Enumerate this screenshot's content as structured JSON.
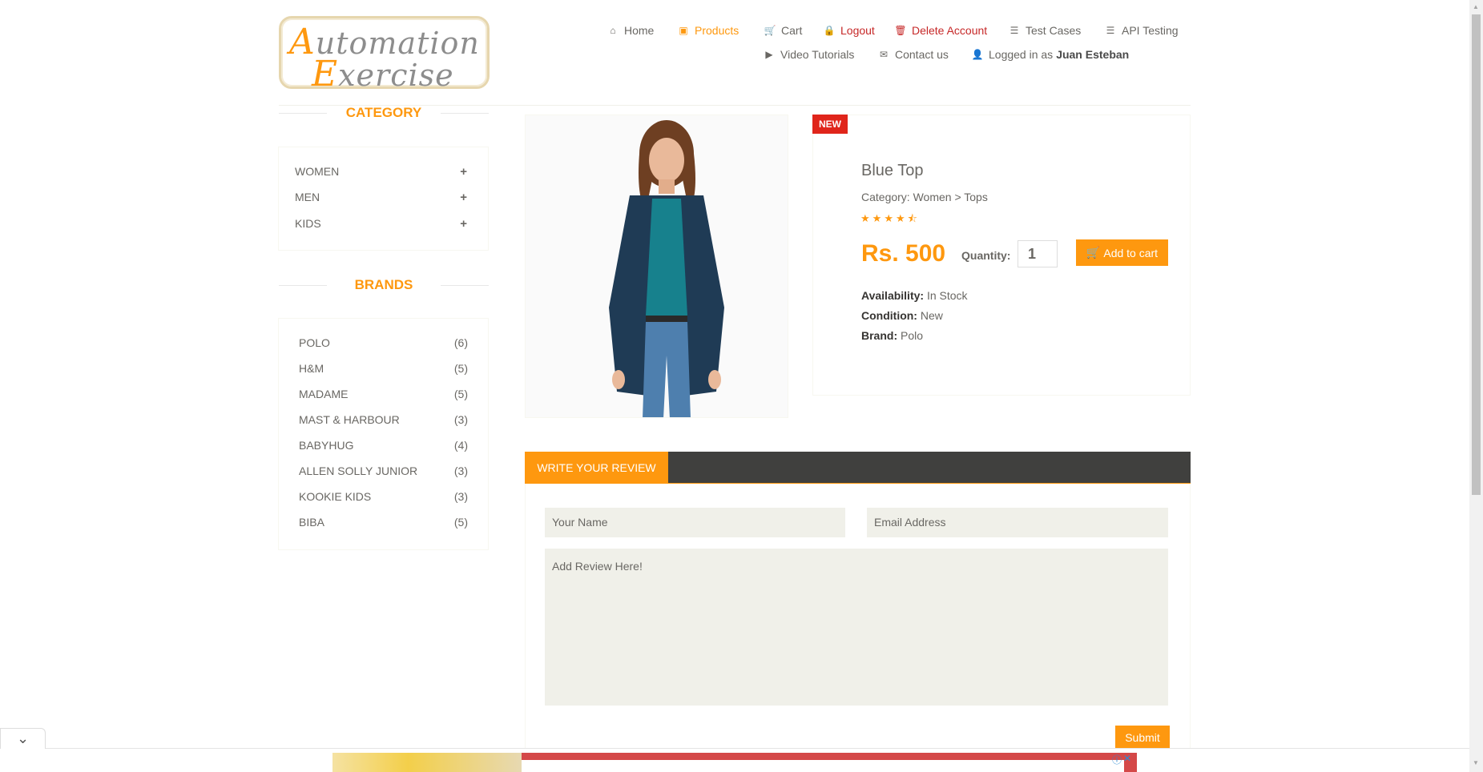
{
  "header": {
    "logo_line1_cap": "A",
    "logo_line1_rest": "utomation",
    "logo_line2_cap": "E",
    "logo_line2_rest": "xercise",
    "nav": {
      "home": "Home",
      "products": "Products",
      "cart": "Cart",
      "logout": "Logout",
      "delete_account": "Delete Account",
      "test_cases": "Test Cases",
      "api_testing": "API Testing",
      "video_tutorials": "Video Tutorials",
      "contact_us": "Contact us",
      "logged_in_prefix": "Logged in as",
      "logged_in_user": "Juan Esteban"
    }
  },
  "sidebar": {
    "category_title": "CATEGORY",
    "categories": [
      "WOMEN",
      "MEN",
      "KIDS"
    ],
    "brands_title": "BRANDS",
    "brands": [
      {
        "name": "POLO",
        "count": "(6)"
      },
      {
        "name": "H&M",
        "count": "(5)"
      },
      {
        "name": "MADAME",
        "count": "(5)"
      },
      {
        "name": "MAST & HARBOUR",
        "count": "(3)"
      },
      {
        "name": "BABYHUG",
        "count": "(4)"
      },
      {
        "name": "ALLEN SOLLY JUNIOR",
        "count": "(3)"
      },
      {
        "name": "KOOKIE KIDS",
        "count": "(3)"
      },
      {
        "name": "BIBA",
        "count": "(5)"
      }
    ]
  },
  "product": {
    "badge": "NEW",
    "name": "Blue Top",
    "category": "Category: Women > Tops",
    "rating": 4.5,
    "price": "Rs. 500",
    "quantity_label": "Quantity:",
    "quantity_value": "1",
    "add_to_cart": "Add to cart",
    "availability_label": "Availability:",
    "availability_value": "In Stock",
    "condition_label": "Condition:",
    "condition_value": "New",
    "brand_label": "Brand:",
    "brand_value": "Polo"
  },
  "review": {
    "tab": "WRITE YOUR REVIEW",
    "name_placeholder": "Your Name",
    "email_placeholder": "Email Address",
    "review_placeholder": "Add Review Here!",
    "submit": "Submit"
  },
  "colors": {
    "accent": "#FE980F",
    "new_badge": "#E0251B",
    "review_bar": "#40403E",
    "logout_red": "#C62828"
  }
}
